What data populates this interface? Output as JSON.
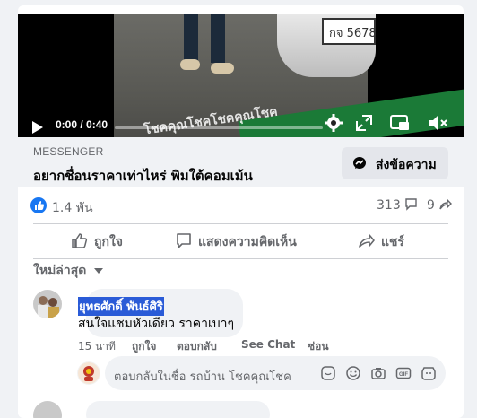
{
  "video": {
    "current_time": "0:00",
    "duration": "0:40",
    "time_display": "0:00 / 0:40",
    "progress": 0.0,
    "plate_text": "กจ 5678",
    "banner_text": "โชคคุณโชคโชคคุณโชค"
  },
  "ad": {
    "source": "MESSENGER",
    "headline": "อยากชื่อนราคาเท่าไหร่ พิมใต้คอมเม้น",
    "send_button": "ส่งข้อความ"
  },
  "stats": {
    "likes": "1.4 พัน",
    "comments": "313",
    "shares": "9"
  },
  "actions": {
    "like": "ถูกใจ",
    "comment": "แสดงความคิดเห็น",
    "share": "แชร์"
  },
  "comments": {
    "sort_label": "ใหม่ล่าสุด",
    "items": [
      {
        "author": "ยุทธศักดิ์ พันธ์ศิริ",
        "text": "สนใจแชมหัวเดียว ราคาเบาๆ",
        "time": "15 นาที",
        "like": "ถูกใจ",
        "reply": "ตอบกลับ",
        "see_chat": "See Chat",
        "hide": "ซ่อน"
      }
    ],
    "reply_placeholder": "ตอบกลับในชื่อ รถบ้าน โชคคุณโชค"
  },
  "colors": {
    "accent": "#1877f2",
    "banner": "#1b7a37",
    "selection": "#2a5bd7"
  },
  "icons": [
    "play-icon",
    "settings-icon",
    "fullscreen-icon",
    "pip-icon",
    "mute-icon",
    "messenger-icon",
    "like-icon",
    "comment-icon",
    "share-icon",
    "chevron-down-icon",
    "sticker-icon",
    "emoji-icon",
    "camera-icon",
    "gif-icon",
    "avatar-sticker-icon"
  ]
}
